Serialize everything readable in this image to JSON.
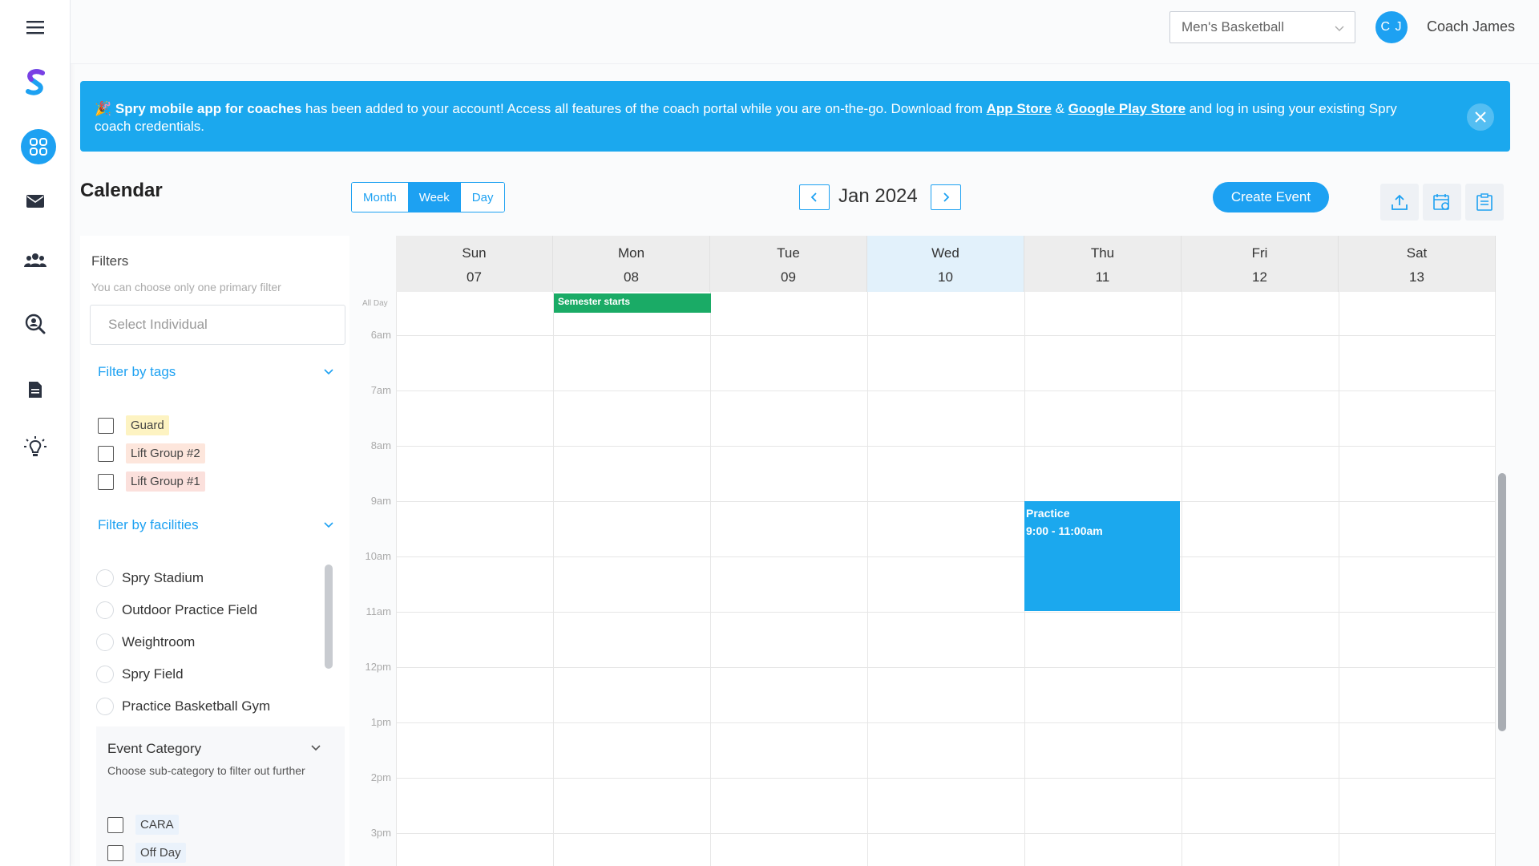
{
  "header": {
    "team_select": "Men's Basketball",
    "avatar_initials": "C J",
    "user_name": "Coach James"
  },
  "banner": {
    "bold_lead": "Spry mobile app for coaches",
    "text_1": " has been added to your account! Access all features of the coach portal while you are on-the-go. Download from ",
    "app_store": "App Store",
    "amp": " & ",
    "play_store": "Google Play Store",
    "text_2": " and log in using your existing Spry coach credentials."
  },
  "calendar": {
    "title": "Calendar",
    "views": [
      "Month",
      "Week",
      "Day"
    ],
    "selected_view": "Week",
    "month_label": "Jan 2024",
    "create_label": "Create Event",
    "days": [
      {
        "name": "Sun",
        "date": "07"
      },
      {
        "name": "Mon",
        "date": "08"
      },
      {
        "name": "Tue",
        "date": "09"
      },
      {
        "name": "Wed",
        "date": "10"
      },
      {
        "name": "Thu",
        "date": "11"
      },
      {
        "name": "Fri",
        "date": "12"
      },
      {
        "name": "Sat",
        "date": "13"
      }
    ],
    "allday_label": "All Day",
    "times": [
      "6am",
      "7am",
      "8am",
      "9am",
      "10am",
      "11am",
      "12pm",
      "1pm",
      "2pm",
      "3pm"
    ],
    "allday_event": "Semester starts",
    "event_title": "Practice",
    "event_time": "9:00 - 11:00am"
  },
  "filters": {
    "heading": "Filters",
    "hint": "You can choose only one primary filter",
    "select_placeholder": "Select Individual",
    "tags_heading": "Filter by tags",
    "tags": [
      {
        "label": "Guard",
        "color": "#fdf3c2"
      },
      {
        "label": "Lift Group #2",
        "color": "#fde6dc"
      },
      {
        "label": "Lift Group #1",
        "color": "#fbe0dc"
      }
    ],
    "facilities_heading": "Filter by facilities",
    "facilities": [
      "Spry Stadium",
      "Outdoor Practice Field",
      "Weightroom",
      "Spry Field",
      "Practice Basketball Gym"
    ],
    "event_category": {
      "title": "Event Category",
      "desc": "Choose sub-category to filter out further",
      "items": [
        "CARA",
        "Off Day"
      ]
    }
  },
  "colors": {
    "accent": "#1da1f2",
    "allday_event": "#1aab66",
    "event": "#1ba8ee"
  }
}
